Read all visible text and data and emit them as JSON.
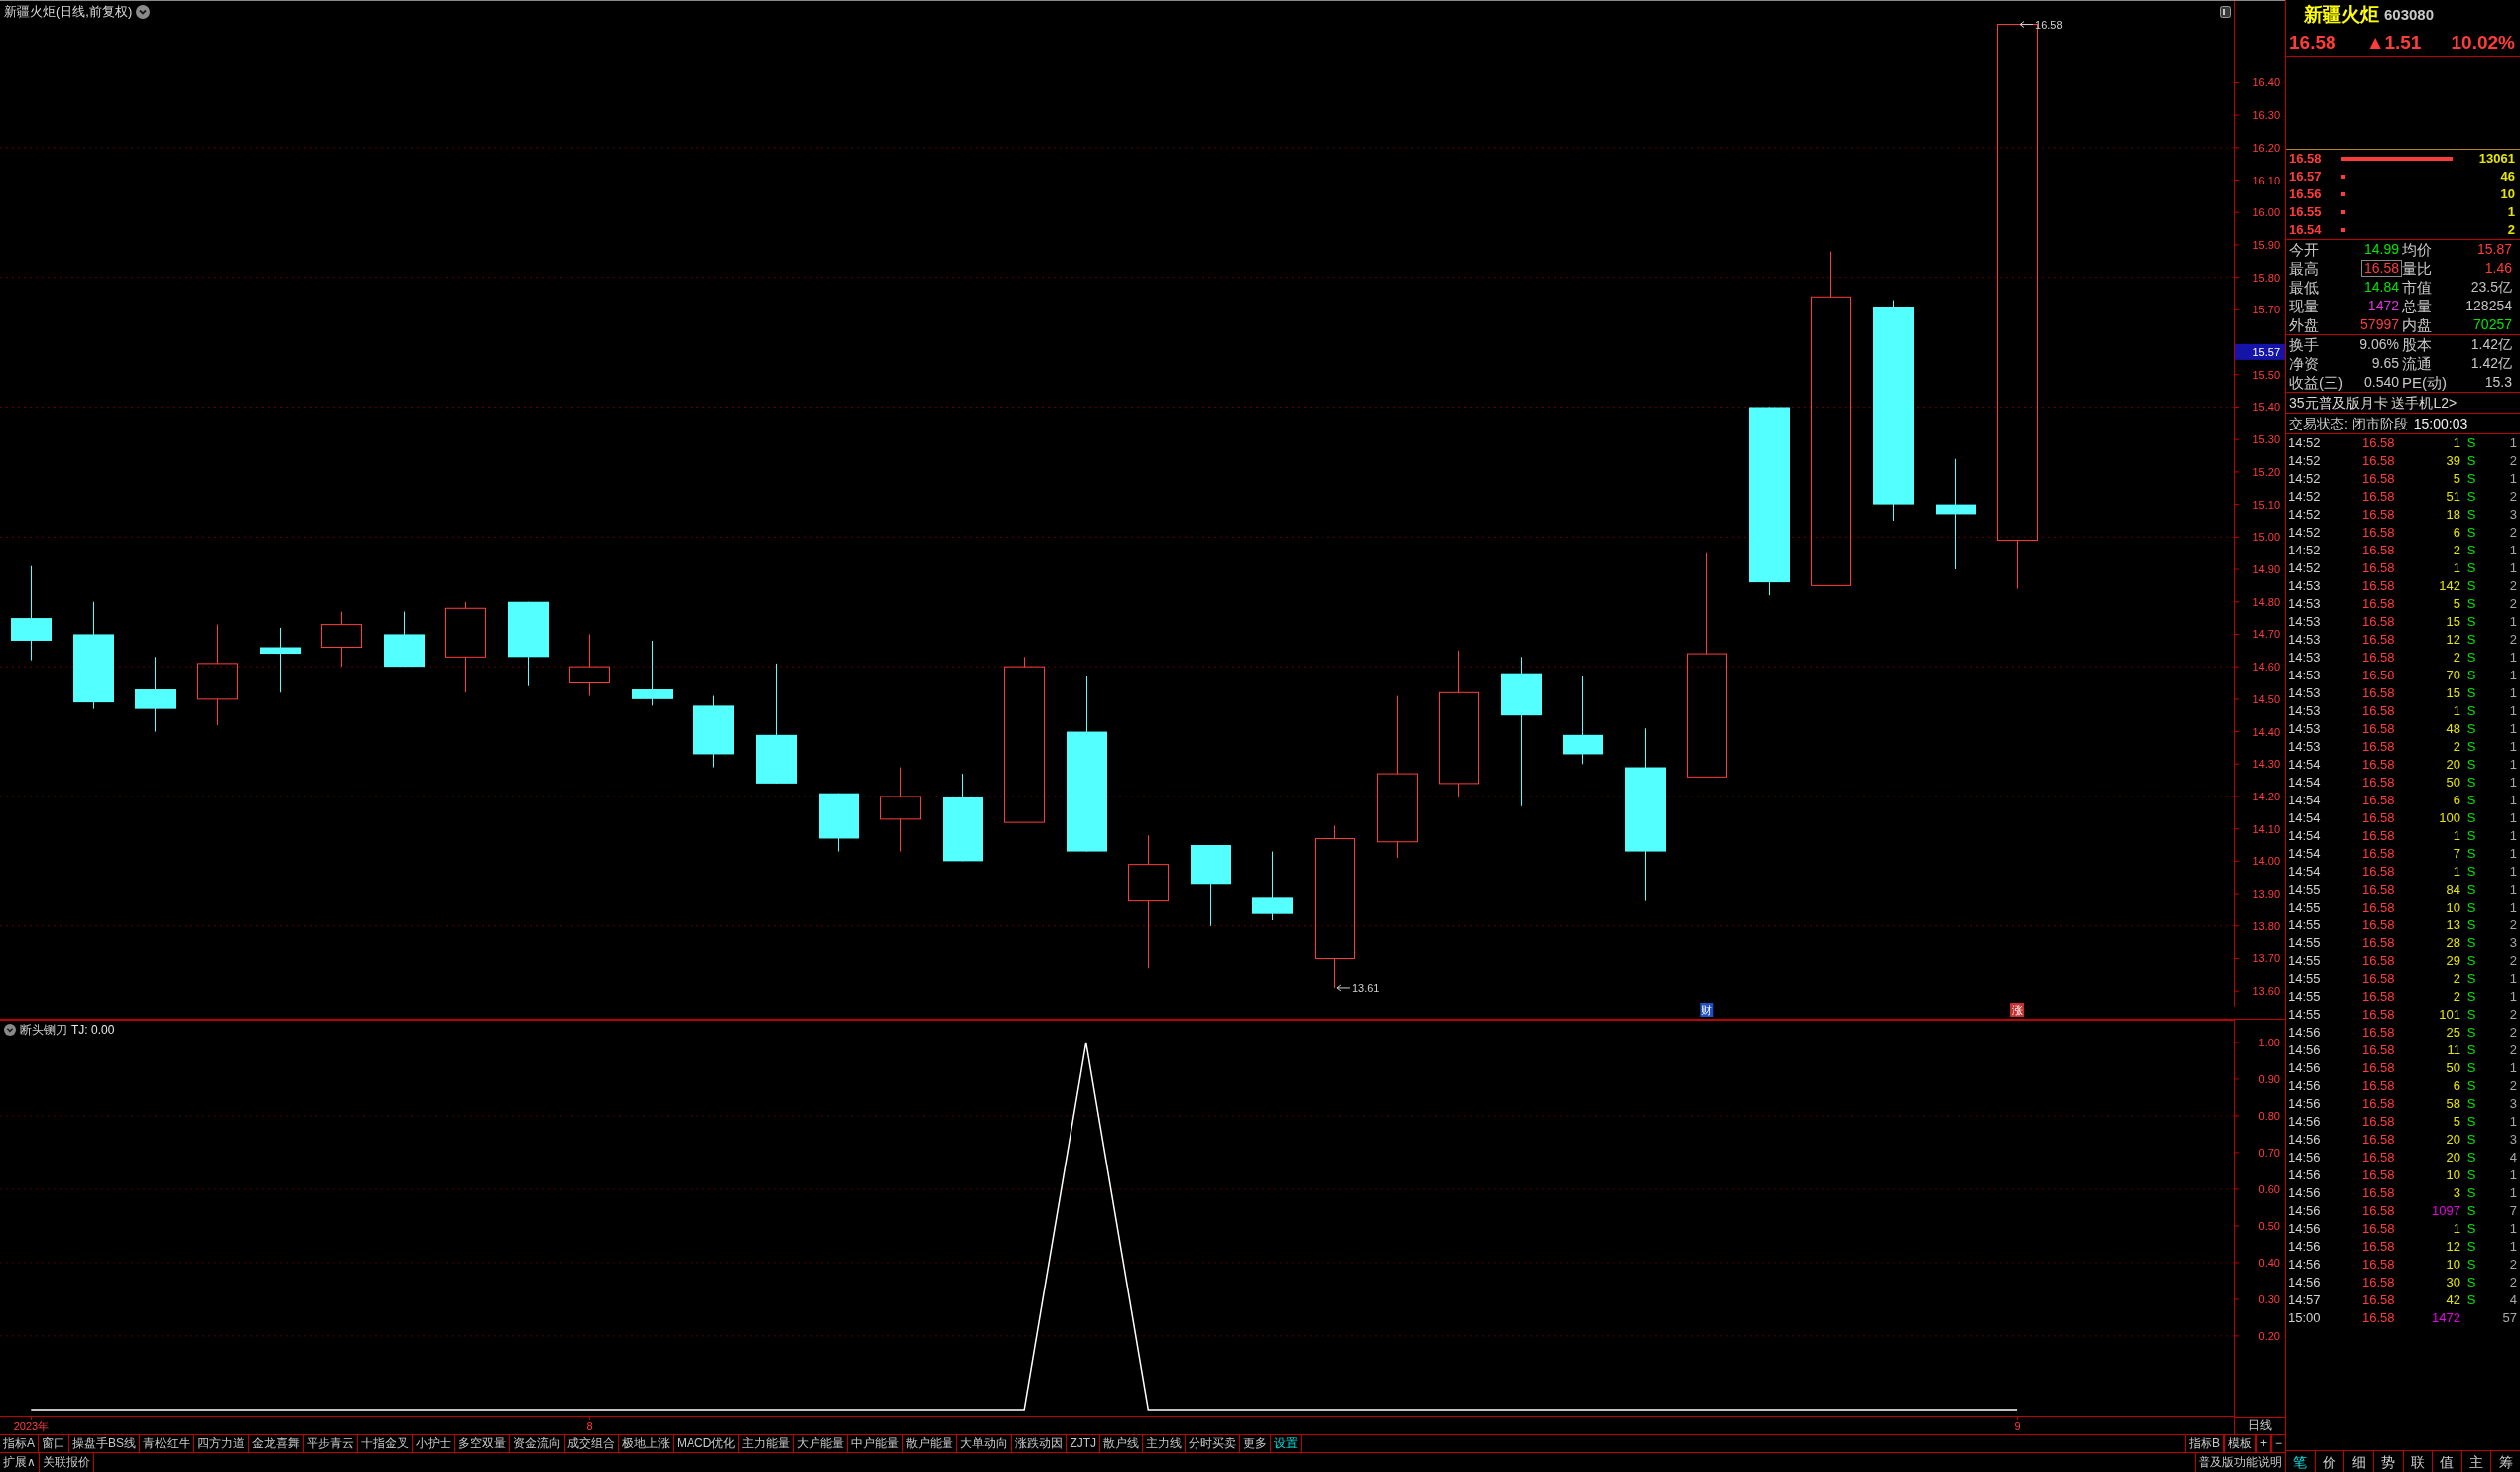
{
  "main_chart": {
    "title": "新疆火炬(日线,前复权)",
    "price_axis": [
      "16.40",
      "16.30",
      "16.20",
      "16.10",
      "16.00",
      "15.90",
      "15.80",
      "15.70",
      "15.50",
      "15.40",
      "15.30",
      "15.20",
      "15.10",
      "15.00",
      "14.90",
      "14.80",
      "14.70",
      "14.60",
      "14.50",
      "14.40",
      "14.30",
      "14.20",
      "14.10",
      "14.00",
      "13.90",
      "13.80",
      "13.70",
      "13.60"
    ],
    "price_callouts": [
      "13.61",
      "16.58"
    ],
    "cursor_price": "15.57",
    "event_markers": [
      {
        "text": "财",
        "color": "#2050c8"
      },
      {
        "text": "涨",
        "color": "#c83030"
      }
    ]
  },
  "indicator_pane": {
    "readout": ": 0.00",
    "chart_data": {
      "type": "line",
      "title": "断头铡刀",
      "grid": true,
      "categories": [
        "2023年",
        null,
        null,
        null,
        null,
        null,
        null,
        null,
        null,
        "8",
        null,
        null,
        null,
        null,
        null,
        null,
        null,
        null,
        null,
        null,
        null,
        null,
        null,
        null,
        null,
        null,
        null,
        null,
        null,
        null,
        null,
        null,
        "9",
        null,
        null,
        null
      ],
      "ylim": [
        -0.022,
        1.062
      ],
      "yticks": [
        {
          "value": 1.0,
          "label": "1.00"
        },
        {
          "value": 0.9,
          "label": "0.90"
        },
        {
          "value": 0.8,
          "label": "0.80"
        },
        {
          "value": 0.7,
          "label": "0.70"
        },
        {
          "value": 0.6,
          "label": "0.60"
        },
        {
          "value": 0.5,
          "label": "0.50"
        },
        {
          "value": 0.4,
          "label": "0.40"
        },
        {
          "value": 0.3,
          "label": "0.30"
        },
        {
          "value": 0.2,
          "label": "0.20"
        }
      ],
      "series": [
        {
          "name": "TJ",
          "color": "#ffffff",
          "values": [
            0,
            0,
            0,
            0,
            0,
            0,
            0,
            0,
            0,
            0,
            0,
            0,
            0,
            0,
            0,
            0,
            0,
            1,
            0,
            0,
            0,
            0,
            0,
            0,
            0,
            0,
            0,
            0,
            0,
            0,
            0,
            0,
            0,
            null,
            null,
            null
          ]
        }
      ]
    }
  },
  "period": "日线",
  "indicator_tabs": [
    {
      "label": "指标A",
      "highlighted": false
    },
    {
      "label": "窗口",
      "highlighted": false
    },
    {
      "label": "操盘手BS线",
      "highlighted": false
    },
    {
      "label": "青松红牛",
      "highlighted": false
    },
    {
      "label": "四方力道",
      "highlighted": false
    },
    {
      "label": "金龙喜舞",
      "highlighted": false
    },
    {
      "label": "平步青云",
      "highlighted": false
    },
    {
      "label": "十指金叉",
      "highlighted": false
    },
    {
      "label": "小护士",
      "highlighted": false
    },
    {
      "label": "多空双量",
      "highlighted": false
    },
    {
      "label": "资金流向",
      "highlighted": false
    },
    {
      "label": "成交组合",
      "highlighted": false
    },
    {
      "label": "极地上涨",
      "highlighted": false
    },
    {
      "label": "MACD优化",
      "highlighted": false
    },
    {
      "label": "主力能量",
      "highlighted": false
    },
    {
      "label": "大户能量",
      "highlighted": false
    },
    {
      "label": "中户能量",
      "highlighted": false
    },
    {
      "label": "散户能量",
      "highlighted": false
    },
    {
      "label": "大单动向",
      "highlighted": false
    },
    {
      "label": "涨跌动因",
      "highlighted": false
    },
    {
      "label": "ZJTJ",
      "highlighted": false
    },
    {
      "label": "散户线",
      "highlighted": false
    },
    {
      "label": "主力线",
      "highlighted": false
    },
    {
      "label": "分时买卖",
      "highlighted": false
    },
    {
      "label": "更多",
      "highlighted": false
    },
    {
      "label": "设置",
      "highlighted": true
    }
  ],
  "indicator_controls": [
    "指标B",
    "模板",
    "+",
    "−"
  ],
  "footer_links": [
    "扩展∧",
    "关联报价"
  ],
  "help_link": "普及版功能说明",
  "quote": {
    "name": "新疆火炬",
    "code": "603080",
    "price": "16.58",
    "change": "▲1.51",
    "change_pct": "10.02%",
    "bids": [
      {
        "price": "16.58",
        "volume": "13061"
      },
      {
        "price": "16.57",
        "volume": "46"
      },
      {
        "price": "16.56",
        "volume": "10"
      },
      {
        "price": "16.55",
        "volume": "1"
      },
      {
        "price": "16.54",
        "volume": "2"
      }
    ],
    "stats": [
      {
        "label": "今开",
        "value": "14.99",
        "color": "#00e600",
        "boxed": false
      },
      {
        "label": "均价",
        "value": "15.87",
        "color": "#ff3c3c",
        "boxed": false
      },
      {
        "label": "最高",
        "value": "16.58",
        "color": "#ff3c3c",
        "boxed": true
      },
      {
        "label": "量比",
        "value": "1.46",
        "color": "#ff3c3c",
        "boxed": false
      },
      {
        "label": "最低",
        "value": "14.84",
        "color": "#00e600",
        "boxed": false
      },
      {
        "label": "市值",
        "value": "23.5亿",
        "color": "#c0c0c0",
        "boxed": false
      },
      {
        "label": "现量",
        "value": "1472",
        "color": "#e030e0",
        "boxed": false
      },
      {
        "label": "总量",
        "value": "128254",
        "color": "#c0c0c0",
        "boxed": false
      },
      {
        "label": "外盘",
        "value": "57997",
        "color": "#ff3c3c",
        "boxed": false
      },
      {
        "label": "内盘",
        "value": "70257",
        "color": "#00e600",
        "boxed": false
      }
    ],
    "fundamentals": [
      {
        "label": "换手",
        "value": "9.06%"
      },
      {
        "label": "股本",
        "value": "1.42亿"
      },
      {
        "label": "净资",
        "value": "9.65"
      },
      {
        "label": "流通",
        "value": "1.42亿"
      },
      {
        "label": "收益(三)",
        "value": "0.540"
      },
      {
        "label": "PE(动)",
        "value": "15.3"
      }
    ],
    "promo": "35元普及版月卡 送手机L2>",
    "status": {
      "label": "交易状态: 闭市阶段",
      "time": "15:00:03"
    }
  },
  "trades": [
    {
      "time": "14:52",
      "price": "16.58",
      "volume": "1",
      "side": "S",
      "count": "1",
      "large": false
    },
    {
      "time": "14:52",
      "price": "16.58",
      "volume": "39",
      "side": "S",
      "count": "2",
      "large": false
    },
    {
      "time": "14:52",
      "price": "16.58",
      "volume": "5",
      "side": "S",
      "count": "1",
      "large": false
    },
    {
      "time": "14:52",
      "price": "16.58",
      "volume": "51",
      "side": "S",
      "count": "2",
      "large": false
    },
    {
      "time": "14:52",
      "price": "16.58",
      "volume": "18",
      "side": "S",
      "count": "3",
      "large": false
    },
    {
      "time": "14:52",
      "price": "16.58",
      "volume": "6",
      "side": "S",
      "count": "2",
      "large": false
    },
    {
      "time": "14:52",
      "price": "16.58",
      "volume": "2",
      "side": "S",
      "count": "1",
      "large": false
    },
    {
      "time": "14:52",
      "price": "16.58",
      "volume": "1",
      "side": "S",
      "count": "1",
      "large": false
    },
    {
      "time": "14:53",
      "price": "16.58",
      "volume": "142",
      "side": "S",
      "count": "2",
      "large": false
    },
    {
      "time": "14:53",
      "price": "16.58",
      "volume": "5",
      "side": "S",
      "count": "2",
      "large": false
    },
    {
      "time": "14:53",
      "price": "16.58",
      "volume": "15",
      "side": "S",
      "count": "1",
      "large": false
    },
    {
      "time": "14:53",
      "price": "16.58",
      "volume": "12",
      "side": "S",
      "count": "2",
      "large": false
    },
    {
      "time": "14:53",
      "price": "16.58",
      "volume": "2",
      "side": "S",
      "count": "1",
      "large": false
    },
    {
      "time": "14:53",
      "price": "16.58",
      "volume": "70",
      "side": "S",
      "count": "1",
      "large": false
    },
    {
      "time": "14:53",
      "price": "16.58",
      "volume": "15",
      "side": "S",
      "count": "1",
      "large": false
    },
    {
      "time": "14:53",
      "price": "16.58",
      "volume": "1",
      "side": "S",
      "count": "1",
      "large": false
    },
    {
      "time": "14:53",
      "price": "16.58",
      "volume": "48",
      "side": "S",
      "count": "1",
      "large": false
    },
    {
      "time": "14:53",
      "price": "16.58",
      "volume": "2",
      "side": "S",
      "count": "1",
      "large": false
    },
    {
      "time": "14:54",
      "price": "16.58",
      "volume": "20",
      "side": "S",
      "count": "1",
      "large": false
    },
    {
      "time": "14:54",
      "price": "16.58",
      "volume": "50",
      "side": "S",
      "count": "1",
      "large": false
    },
    {
      "time": "14:54",
      "price": "16.58",
      "volume": "6",
      "side": "S",
      "count": "1",
      "large": false
    },
    {
      "time": "14:54",
      "price": "16.58",
      "volume": "100",
      "side": "S",
      "count": "1",
      "large": false
    },
    {
      "time": "14:54",
      "price": "16.58",
      "volume": "1",
      "side": "S",
      "count": "1",
      "large": false
    },
    {
      "time": "14:54",
      "price": "16.58",
      "volume": "7",
      "side": "S",
      "count": "1",
      "large": false
    },
    {
      "time": "14:54",
      "price": "16.58",
      "volume": "1",
      "side": "S",
      "count": "1",
      "large": false
    },
    {
      "time": "14:55",
      "price": "16.58",
      "volume": "84",
      "side": "S",
      "count": "1",
      "large": false
    },
    {
      "time": "14:55",
      "price": "16.58",
      "volume": "10",
      "side": "S",
      "count": "1",
      "large": false
    },
    {
      "time": "14:55",
      "price": "16.58",
      "volume": "13",
      "side": "S",
      "count": "2",
      "large": false
    },
    {
      "time": "14:55",
      "price": "16.58",
      "volume": "28",
      "side": "S",
      "count": "3",
      "large": false
    },
    {
      "time": "14:55",
      "price": "16.58",
      "volume": "29",
      "side": "S",
      "count": "2",
      "large": false
    },
    {
      "time": "14:55",
      "price": "16.58",
      "volume": "2",
      "side": "S",
      "count": "1",
      "large": false
    },
    {
      "time": "14:55",
      "price": "16.58",
      "volume": "2",
      "side": "S",
      "count": "1",
      "large": false
    },
    {
      "time": "14:55",
      "price": "16.58",
      "volume": "101",
      "side": "S",
      "count": "2",
      "large": false
    },
    {
      "time": "14:56",
      "price": "16.58",
      "volume": "25",
      "side": "S",
      "count": "2",
      "large": false
    },
    {
      "time": "14:56",
      "price": "16.58",
      "volume": "11",
      "side": "S",
      "count": "2",
      "large": false
    },
    {
      "time": "14:56",
      "price": "16.58",
      "volume": "50",
      "side": "S",
      "count": "1",
      "large": false
    },
    {
      "time": "14:56",
      "price": "16.58",
      "volume": "6",
      "side": "S",
      "count": "2",
      "large": false
    },
    {
      "time": "14:56",
      "price": "16.58",
      "volume": "58",
      "side": "S",
      "count": "3",
      "large": false
    },
    {
      "time": "14:56",
      "price": "16.58",
      "volume": "5",
      "side": "S",
      "count": "1",
      "large": false
    },
    {
      "time": "14:56",
      "price": "16.58",
      "volume": "20",
      "side": "S",
      "count": "3",
      "large": false
    },
    {
      "time": "14:56",
      "price": "16.58",
      "volume": "20",
      "side": "S",
      "count": "4",
      "large": false
    },
    {
      "time": "14:56",
      "price": "16.58",
      "volume": "10",
      "side": "S",
      "count": "1",
      "large": false
    },
    {
      "time": "14:56",
      "price": "16.58",
      "volume": "3",
      "side": "S",
      "count": "1",
      "large": false
    },
    {
      "time": "14:56",
      "price": "16.58",
      "volume": "1097",
      "side": "S",
      "count": "7",
      "large": true
    },
    {
      "time": "14:56",
      "price": "16.58",
      "volume": "1",
      "side": "S",
      "count": "1",
      "large": false
    },
    {
      "time": "14:56",
      "price": "16.58",
      "volume": "12",
      "side": "S",
      "count": "1",
      "large": false
    },
    {
      "time": "14:56",
      "price": "16.58",
      "volume": "10",
      "side": "S",
      "count": "2",
      "large": false
    },
    {
      "time": "14:56",
      "price": "16.58",
      "volume": "30",
      "side": "S",
      "count": "2",
      "large": false
    },
    {
      "time": "14:57",
      "price": "16.58",
      "volume": "42",
      "side": "S",
      "count": "4",
      "large": false
    },
    {
      "time": "15:00",
      "price": "16.58",
      "volume": "1472",
      "count": "57",
      "large": true
    }
  ],
  "detail_tabs": [
    {
      "label": "笔",
      "selected": true
    },
    {
      "label": "价",
      "selected": false
    },
    {
      "label": "细",
      "selected": false
    },
    {
      "label": "势",
      "selected": false
    },
    {
      "label": "联",
      "selected": false
    },
    {
      "label": "值",
      "selected": false
    },
    {
      "label": "主",
      "selected": false
    },
    {
      "label": "筹",
      "selected": false
    }
  ]
}
